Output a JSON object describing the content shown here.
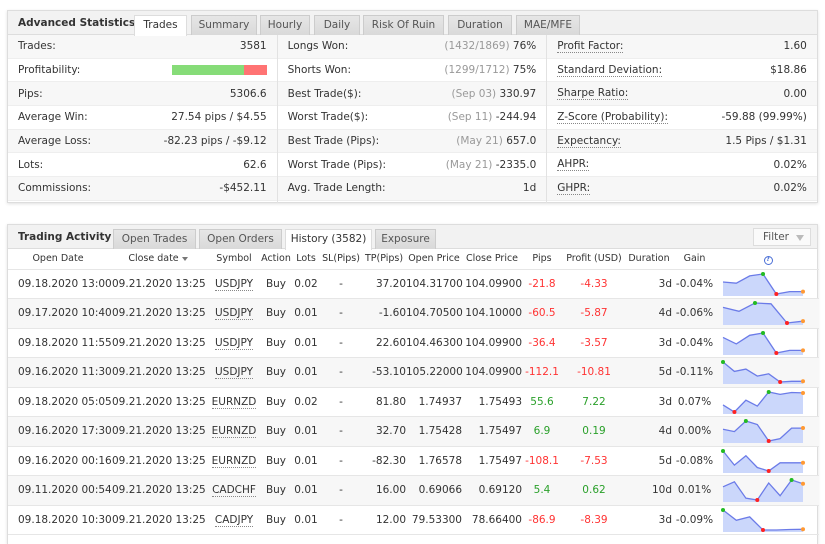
{
  "advanced": {
    "title": "Advanced Statistics",
    "tabs": [
      {
        "label": "Trades",
        "active": true
      },
      {
        "label": "Summary"
      },
      {
        "label": "Hourly"
      },
      {
        "label": "Daily"
      },
      {
        "label": "Risk Of Ruin"
      },
      {
        "label": "Duration"
      },
      {
        "label": "MAE/MFE"
      }
    ],
    "col1": [
      {
        "label": "Trades:",
        "value": "3581"
      },
      {
        "label": "Profitability:",
        "profit_fraction": 0.76
      },
      {
        "label": "Pips:",
        "value": "5306.6"
      },
      {
        "label": "Average Win:",
        "value": "27.54 pips / $4.55"
      },
      {
        "label": "Average Loss:",
        "value": "-82.23 pips / -$9.12"
      },
      {
        "label": "Lots:",
        "value": "62.6"
      },
      {
        "label": "Commissions:",
        "value": "-$452.11"
      }
    ],
    "col2": [
      {
        "label": "Longs Won:",
        "sub": "(1432/1869)",
        "value": "76%"
      },
      {
        "label": "Shorts Won:",
        "sub": "(1299/1712)",
        "value": "75%"
      },
      {
        "label": "Best Trade($):",
        "sub": "(Sep 03)",
        "value": "330.97"
      },
      {
        "label": "Worst Trade($):",
        "sub": "(Sep 11)",
        "value": "-244.94"
      },
      {
        "label": "Best Trade (Pips):",
        "sub": "(May 21)",
        "value": "657.0"
      },
      {
        "label": "Worst Trade (Pips):",
        "sub": "(May 21)",
        "value": "-2335.0"
      },
      {
        "label": "Avg. Trade Length:",
        "sub": "",
        "value": "1d"
      }
    ],
    "col3": [
      {
        "label": "Profit Factor:",
        "value": "1.60"
      },
      {
        "label": "Standard Deviation:",
        "value": "$18.86"
      },
      {
        "label": "Sharpe Ratio:",
        "value": "0.00"
      },
      {
        "label": "Z-Score (Probability):",
        "value": "-59.88 (99.99%)"
      },
      {
        "label": "Expectancy:",
        "value": "1.5 Pips / $1.31"
      },
      {
        "label": "AHPR:",
        "value": "0.02%"
      },
      {
        "label": "GHPR:",
        "value": "0.02%"
      }
    ]
  },
  "activity": {
    "title": "Trading Activity",
    "tabs": [
      {
        "label": "Open Trades"
      },
      {
        "label": "Open Orders"
      },
      {
        "label": "History (3582)",
        "active": true
      },
      {
        "label": "Exposure"
      }
    ],
    "filter_label": "Filter",
    "columns": [
      "Open Date",
      "Close date",
      "Symbol",
      "Action",
      "Lots",
      "SL(Pips)",
      "TP(Pips)",
      "Open Price",
      "Close Price",
      "Pips",
      "Profit (USD)",
      "Duration",
      "Gain"
    ],
    "help_icon": "?",
    "colors": {
      "positive": "#2aa02a",
      "negative": "#ff3333",
      "spark_line": "#6b7be8",
      "spark_fill": "#cbd7fb",
      "spark_max": "#22bb22",
      "spark_min": "#ff2222",
      "spark_last": "#ff9933"
    },
    "rows": [
      {
        "open": "09.18.2020 13:00",
        "close": "09.21.2020 13:25",
        "symbol": "USDJPY",
        "action": "Buy",
        "lots": "0.02",
        "sl": "-",
        "tp": "37.20",
        "open_price": "104.31700",
        "close_price": "104.09900",
        "pips": "-21.8",
        "profit": "-4.33",
        "duration": "3d",
        "gain": "-0.04%",
        "spark": [
          6,
          5.5,
          8.5,
          9.3,
          1,
          2,
          2
        ]
      },
      {
        "open": "09.17.2020 10:40",
        "close": "09.21.2020 13:25",
        "symbol": "USDJPY",
        "action": "Buy",
        "lots": "0.01",
        "sl": "-",
        "tp": "-1.60",
        "open_price": "104.70500",
        "close_price": "104.10000",
        "pips": "-60.5",
        "profit": "-5.87",
        "duration": "4d",
        "gain": "-0.06%",
        "spark": [
          7,
          5.5,
          8.7,
          8.4,
          1,
          1.7
        ]
      },
      {
        "open": "09.18.2020 11:55",
        "close": "09.21.2020 13:25",
        "symbol": "USDJPY",
        "action": "Buy",
        "lots": "0.01",
        "sl": "-",
        "tp": "22.60",
        "open_price": "104.46300",
        "close_price": "104.09900",
        "pips": "-36.4",
        "profit": "-3.57",
        "duration": "3d",
        "gain": "-0.04%",
        "spark": [
          7,
          4.5,
          7.8,
          8.7,
          1,
          2,
          2
        ]
      },
      {
        "open": "09.16.2020 11:30",
        "close": "09.21.2020 13:25",
        "symbol": "USDJPY",
        "action": "Buy",
        "lots": "0.01",
        "sl": "-",
        "tp": "-53.10",
        "open_price": "105.22000",
        "close_price": "104.09900",
        "pips": "-112.1",
        "profit": "-10.81",
        "duration": "5d",
        "gain": "-0.11%",
        "spark": [
          9,
          5,
          6,
          3,
          4,
          0.5,
          0.8,
          0.8
        ]
      },
      {
        "open": "09.18.2020 05:05",
        "close": "09.21.2020 13:25",
        "symbol": "EURNZD",
        "action": "Buy",
        "lots": "0.02",
        "sl": "-",
        "tp": "81.80",
        "open_price": "1.74937",
        "close_price": "1.75493",
        "pips": "55.6",
        "profit": "7.22",
        "duration": "3d",
        "gain": "0.07%",
        "spark": [
          3.5,
          0.5,
          5.5,
          3,
          9,
          8,
          8.8,
          8.6
        ]
      },
      {
        "open": "09.16.2020 17:30",
        "close": "09.21.2020 13:25",
        "symbol": "EURNZD",
        "action": "Buy",
        "lots": "0.01",
        "sl": "-",
        "tp": "32.70",
        "open_price": "1.75428",
        "close_price": "1.75497",
        "pips": "6.9",
        "profit": "0.19",
        "duration": "4d",
        "gain": "0.00%",
        "spark": [
          5.5,
          4.5,
          9,
          7.5,
          0.5,
          1.5,
          6,
          6
        ]
      },
      {
        "open": "09.16.2020 00:16",
        "close": "09.21.2020 13:25",
        "symbol": "EURNZD",
        "action": "Buy",
        "lots": "0.01",
        "sl": "-",
        "tp": "-82.30",
        "open_price": "1.76578",
        "close_price": "1.75497",
        "pips": "-108.1",
        "profit": "-7.53",
        "duration": "5d",
        "gain": "-0.08%",
        "spark": [
          9,
          3,
          7,
          2,
          0.5,
          4,
          4,
          4
        ]
      },
      {
        "open": "09.11.2020 00:54",
        "close": "09.21.2020 13:25",
        "symbol": "CADCHF",
        "action": "Buy",
        "lots": "0.01",
        "sl": "-",
        "tp": "16.00",
        "open_price": "0.69066",
        "close_price": "0.69120",
        "pips": "5.4",
        "profit": "0.62",
        "duration": "10d",
        "gain": "0.01%",
        "spark": [
          6,
          8,
          1.5,
          0.8,
          7.5,
          2.5,
          8.7,
          7.2
        ]
      },
      {
        "open": "09.18.2020 10:30",
        "close": "09.21.2020 13:25",
        "symbol": "CADJPY",
        "action": "Buy",
        "lots": "0.01",
        "sl": "-",
        "tp": "12.00",
        "open_price": "79.53300",
        "close_price": "78.66400",
        "pips": "-86.9",
        "profit": "-8.39",
        "duration": "3d",
        "gain": "-0.09%",
        "spark": [
          9,
          4.5,
          6,
          0.3,
          0.3,
          0.5,
          0.6
        ]
      }
    ]
  }
}
